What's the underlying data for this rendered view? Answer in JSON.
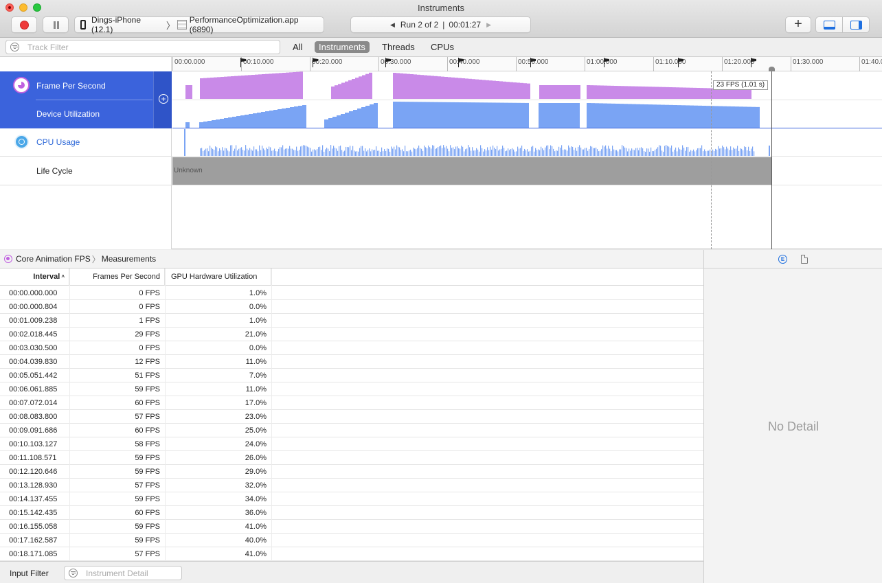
{
  "window": {
    "title": "Instruments"
  },
  "toolbar": {
    "device": "Dings-iPhone (12.1)",
    "process": "PerformanceOptimization.app (6890)",
    "run_label": "Run 2 of 2",
    "run_separator": "|",
    "run_time": "00:01:27",
    "add_label": "+"
  },
  "filter_bar": {
    "track_filter_placeholder": "Track Filter",
    "scopes": [
      "All",
      "Instruments",
      "Threads",
      "CPUs"
    ],
    "active_scope": "Instruments"
  },
  "timeline": {
    "ticks": [
      "00:00.000",
      "00:10.000",
      "00:20.000",
      "00:30.000",
      "00:40.000",
      "00:50.000",
      "01:00.000",
      "01:10.000",
      "01:20.000",
      "01:30.000",
      "01:40.0"
    ],
    "tracks": {
      "fps_label": "Frame Per Second",
      "device_util_label": "Device Utilization",
      "cpu_label": "CPU Usage",
      "lifecycle_label": "Life Cycle",
      "lifecycle_state": "Unknown"
    },
    "fps_tooltip": "23 FPS (1.01 s)",
    "colors": {
      "fps": "#c98ae8",
      "device": "#7aa4f4",
      "cpu": "#7aa4f4",
      "selection": "#3b63dc"
    }
  },
  "detail": {
    "breadcrumb_instrument": "Core Animation FPS",
    "breadcrumb_view": "Measurements",
    "columns": [
      "Interval",
      "Frames Per Second",
      "GPU Hardware Utilization"
    ],
    "sort_indicator": "^",
    "rows": [
      [
        "00:00.000.000",
        "0 FPS",
        "1.0%"
      ],
      [
        "00:00.000.804",
        "0 FPS",
        "0.0%"
      ],
      [
        "00:01.009.238",
        "1 FPS",
        "1.0%"
      ],
      [
        "00:02.018.445",
        "29 FPS",
        "21.0%"
      ],
      [
        "00:03.030.500",
        "0 FPS",
        "0.0%"
      ],
      [
        "00:04.039.830",
        "12 FPS",
        "11.0%"
      ],
      [
        "00:05.051.442",
        "51 FPS",
        "7.0%"
      ],
      [
        "00:06.061.885",
        "59 FPS",
        "11.0%"
      ],
      [
        "00:07.072.014",
        "60 FPS",
        "17.0%"
      ],
      [
        "00:08.083.800",
        "57 FPS",
        "23.0%"
      ],
      [
        "00:09.091.686",
        "60 FPS",
        "25.0%"
      ],
      [
        "00:10.103.127",
        "58 FPS",
        "24.0%"
      ],
      [
        "00:11.108.571",
        "59 FPS",
        "26.0%"
      ],
      [
        "00:12.120.646",
        "59 FPS",
        "29.0%"
      ],
      [
        "00:13.128.930",
        "57 FPS",
        "32.0%"
      ],
      [
        "00:14.137.455",
        "59 FPS",
        "34.0%"
      ],
      [
        "00:15.142.435",
        "60 FPS",
        "36.0%"
      ],
      [
        "00:16.155.058",
        "59 FPS",
        "41.0%"
      ],
      [
        "00:17.162.587",
        "59 FPS",
        "40.0%"
      ],
      [
        "00:18.171.085",
        "57 FPS",
        "41.0%"
      ]
    ]
  },
  "inspector": {
    "empty_label": "No Detail",
    "extended_icon_letter": "E"
  },
  "footer": {
    "input_filter_label": "Input Filter",
    "instrument_detail_placeholder": "Instrument Detail"
  }
}
